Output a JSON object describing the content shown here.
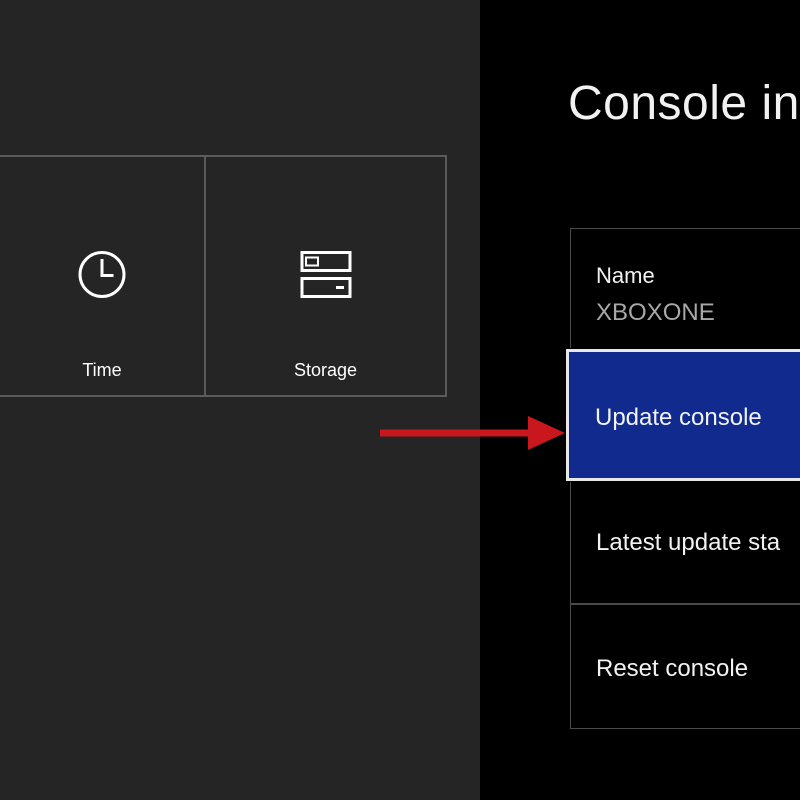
{
  "left_panel": {
    "tiles": [
      {
        "label": "Time",
        "icon": "clock-icon"
      },
      {
        "label": "Storage",
        "icon": "storage-icon"
      }
    ]
  },
  "right_panel": {
    "title": "Console in",
    "items": {
      "name_label": "Name",
      "name_value": "XBOXONE",
      "update": "Update console",
      "latest": "Latest update sta",
      "reset": "Reset console"
    }
  },
  "annotation": {
    "arrow_color": "#c8181e"
  },
  "colors": {
    "selected_bg": "#102a8d",
    "left_bg": "#252525",
    "right_bg": "#000000"
  }
}
